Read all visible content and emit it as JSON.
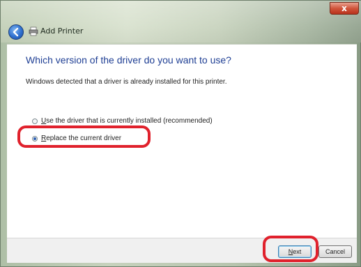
{
  "window": {
    "title": "Add Printer",
    "close_glyph": "x"
  },
  "content": {
    "heading": "Which version of the driver do you want to use?",
    "description": "Windows detected that a driver is already installed for this printer.",
    "options": [
      {
        "prefix": "",
        "underline": "U",
        "rest": "se the driver that is currently installed (recommended)",
        "selected": false
      },
      {
        "prefix": "",
        "underline": "R",
        "rest": "eplace the current driver",
        "selected": true
      }
    ]
  },
  "footer": {
    "next_underline": "N",
    "next_rest": "ext",
    "cancel_label": "Cancel"
  },
  "colors": {
    "heading": "#1f3f94",
    "highlight": "#e0212c"
  },
  "icons": [
    "back-arrow-icon",
    "printer-icon",
    "close-icon"
  ]
}
